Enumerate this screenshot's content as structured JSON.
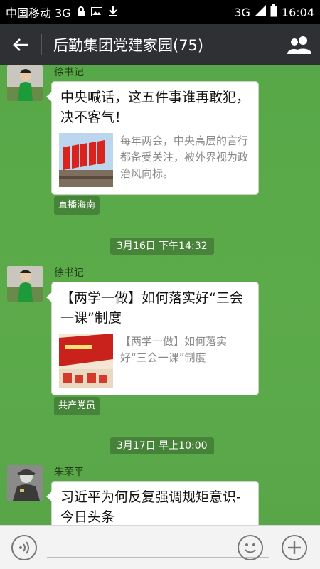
{
  "statusbar": {
    "carrier": "中国移动 3G",
    "network": "3G",
    "clock": "16:04"
  },
  "header": {
    "title": "后勤集团党建家园(75)"
  },
  "messages": [
    {
      "sender": "徐书记",
      "title": "中央喊话，这五件事谁再敢犯，决不客气！",
      "desc": "每年两会，中央高层的言行都备受关注，被外界视为政治风向标。",
      "source": "直播海南"
    },
    {
      "sender": "徐书记",
      "title": "【两学一做】如何落实好“三会一课”制度",
      "desc": "【两学一做】如何落实好“三会一课”制度",
      "source": "共产党员"
    },
    {
      "sender": "朱荣平",
      "title": "习近平为何反复强调规矩意识-今日头条"
    }
  ],
  "timestamps": [
    "3月16日 下午14:32",
    "3月17日 早上10:00"
  ],
  "input": {
    "placeholder": ""
  },
  "colors": {
    "chat_background": "#5aa84a",
    "titlebar": "#2f3033",
    "bubble": "#ffffff"
  }
}
